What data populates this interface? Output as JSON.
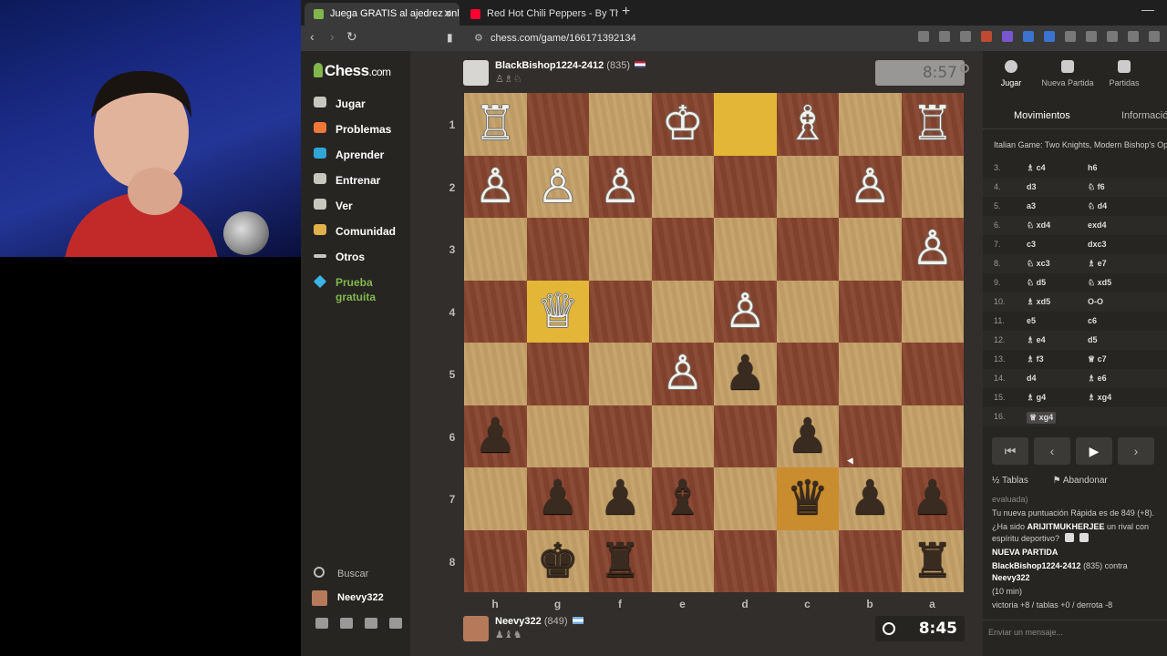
{
  "browser": {
    "tabs": [
      {
        "title": "Juega GRATIS al ajedrez online -",
        "active": true,
        "icon_color": "#81b64c"
      },
      {
        "title": "Red Hot Chili Peppers - By The W",
        "active": false,
        "icon_color": "#ff0033"
      }
    ],
    "url": "chess.com/game/166171392134"
  },
  "sidebar": {
    "logo_main": "Chess",
    "logo_suffix": ".com",
    "items": [
      {
        "label": "Jugar",
        "icon": "pawn-icon",
        "color": "#c9c6c0"
      },
      {
        "label": "Problemas",
        "icon": "puzzle-icon",
        "color": "#f0773a"
      },
      {
        "label": "Aprender",
        "icon": "graduation-icon",
        "color": "#2fa7d6"
      },
      {
        "label": "Entrenar",
        "icon": "training-icon",
        "color": "#c9c6c0"
      },
      {
        "label": "Ver",
        "icon": "binoculars-icon",
        "color": "#c9c6c0"
      },
      {
        "label": "Comunidad",
        "icon": "community-icon",
        "color": "#e0b24a"
      },
      {
        "label": "Otros",
        "icon": "more-icon",
        "color": "#c9c6c0"
      }
    ],
    "promo": "Prueba gratuita",
    "search": "Buscar",
    "user": "Neevy322"
  },
  "top_player": {
    "name": "BlackBishop1224-2412",
    "rating": "(835)",
    "clock": "8:57"
  },
  "bottom_player": {
    "name": "Neevy322",
    "rating": "(849)",
    "clock": "8:45"
  },
  "board": {
    "ranks": [
      "1",
      "2",
      "3",
      "4",
      "5",
      "6",
      "7",
      "8"
    ],
    "files": [
      "h",
      "g",
      "f",
      "e",
      "d",
      "c",
      "b",
      "a"
    ],
    "squares": [
      [
        "♖",
        "",
        "",
        "♔",
        "",
        "♗",
        "",
        "♖"
      ],
      [
        "♙",
        "♙",
        "♙",
        "",
        "",
        "",
        "♙",
        ""
      ],
      [
        "",
        "",
        "",
        "",
        "",
        "",
        "",
        "♙"
      ],
      [
        "",
        "♕",
        "",
        "",
        "♙",
        "",
        "",
        ""
      ],
      [
        "",
        "",
        "",
        "♙",
        "♟",
        "",
        "",
        ""
      ],
      [
        "♟",
        "",
        "",
        "",
        "",
        "♟",
        "",
        ""
      ],
      [
        "",
        "♟",
        "♟",
        "♝",
        "",
        "♛",
        "♟",
        "♟"
      ],
      [
        "",
        "♚",
        "♜",
        "",
        "",
        "",
        "",
        "♜"
      ]
    ],
    "highlights": [
      [
        0,
        4
      ],
      [
        3,
        1
      ],
      [
        6,
        5
      ]
    ]
  },
  "panel": {
    "tabs": [
      {
        "label": "Jugar",
        "icon": "stopwatch-icon"
      },
      {
        "label": "Nueva Partida",
        "icon": "plus-icon"
      },
      {
        "label": "Partidas",
        "icon": "grid-icon"
      }
    ],
    "subtab_moves": "Movimientos",
    "subtab_info": "Información",
    "opening": "Italian Game: Two Knights, Modern Bishop's Op",
    "moves": [
      {
        "n": "3.",
        "w": "♗ c4",
        "b": "h6"
      },
      {
        "n": "4.",
        "w": "d3",
        "b": "♘ f6"
      },
      {
        "n": "5.",
        "w": "a3",
        "b": "♘ d4"
      },
      {
        "n": "6.",
        "w": "♘ xd4",
        "b": "exd4"
      },
      {
        "n": "7.",
        "w": "c3",
        "b": "dxc3"
      },
      {
        "n": "8.",
        "w": "♘ xc3",
        "b": "♗ e7"
      },
      {
        "n": "9.",
        "w": "♘ d5",
        "b": "♘ xd5"
      },
      {
        "n": "10.",
        "w": "♗ xd5",
        "b": "O-O"
      },
      {
        "n": "11.",
        "w": "e5",
        "b": "c6"
      },
      {
        "n": "12.",
        "w": "♗ e4",
        "b": "d5"
      },
      {
        "n": "13.",
        "w": "♗ f3",
        "b": "♕ c7"
      },
      {
        "n": "14.",
        "w": "d4",
        "b": "♗ e6"
      },
      {
        "n": "15.",
        "w": "♗ g4",
        "b": "♗ xg4"
      },
      {
        "n": "16.",
        "w": "♕ xg4",
        "b": ""
      }
    ],
    "draw": "Tablas",
    "resign": "Abandonar",
    "chat": {
      "line1": "evaluada)",
      "line2": "Tu nueva puntuación Rápida es de 849 (+8).",
      "line3_a": "¿Ha sido ",
      "line3_b": "ARIJITMUKHERJEE",
      "line3_c": " un rival con espíritu deportivo?",
      "new_game": "NUEVA PARTIDA",
      "match_a": "BlackBishop1224-2412",
      "match_b": " (835) contra ",
      "match_c": "Neevy322",
      "time": "(10 min)",
      "result": "victoria +8 / tablas +0 / derrota -8"
    },
    "input_placeholder": "Enviar un mensaje..."
  }
}
